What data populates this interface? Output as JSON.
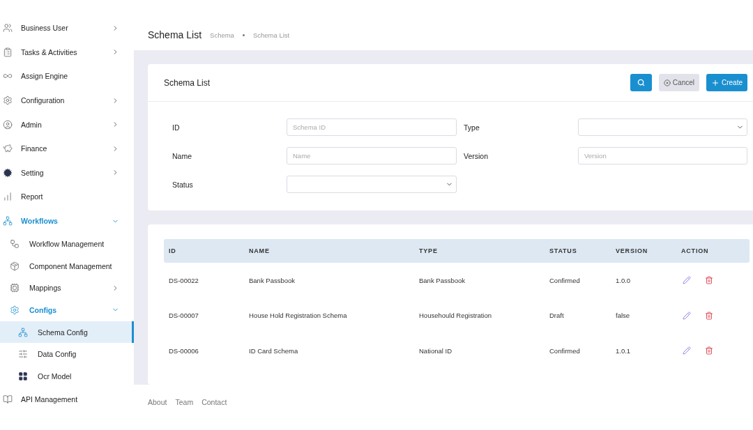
{
  "sidebar": {
    "items": [
      {
        "label": "Business User",
        "expanded": false,
        "selected": false
      },
      {
        "label": "Tasks & Activities",
        "expanded": false,
        "selected": false
      },
      {
        "label": "Assign Engine",
        "selected": false
      },
      {
        "label": "Configuration",
        "expanded": false,
        "selected": false
      },
      {
        "label": "Admin",
        "expanded": false,
        "selected": false
      },
      {
        "label": "Finance",
        "expanded": false,
        "selected": false
      },
      {
        "label": "Setting",
        "expanded": false,
        "selected": false
      },
      {
        "label": "Report",
        "selected": false
      },
      {
        "label": "Workflows",
        "expanded": true,
        "selected": false,
        "children": [
          {
            "label": "Workflow Management",
            "selected": false
          },
          {
            "label": "Component Management",
            "selected": false
          },
          {
            "label": "Mappings",
            "expanded": false,
            "selected": false
          },
          {
            "label": "Configs",
            "expanded": true,
            "selected": false,
            "children": [
              {
                "label": "Schema Config",
                "selected": true
              },
              {
                "label": "Data Config",
                "selected": false
              },
              {
                "label": "Ocr Model",
                "selected": false
              }
            ]
          }
        ]
      },
      {
        "label": "API Management",
        "selected": false
      }
    ]
  },
  "header": {
    "title": "Schema List",
    "breadcrumb": [
      "Schema",
      "Schema List"
    ]
  },
  "filter_card": {
    "title": "Schema List",
    "buttons": [
      {
        "kind": "search"
      },
      {
        "kind": "cancel",
        "label": "Cancel"
      },
      {
        "kind": "create",
        "label": "Create"
      }
    ],
    "fields": [
      {
        "label": "ID",
        "kind": "text",
        "placeholder": "Schema ID"
      },
      {
        "label": "Type",
        "kind": "select"
      },
      {
        "label": "Name",
        "kind": "text",
        "placeholder": "Name"
      },
      {
        "label": "Version",
        "kind": "text",
        "placeholder": "Version"
      },
      {
        "label": "Status",
        "kind": "select"
      }
    ]
  },
  "table": {
    "columns": [
      "ID",
      "NAME",
      "TYPE",
      "STATUS",
      "VERSION",
      "ACTION"
    ],
    "rows": [
      {
        "cells": [
          "DS-00022",
          "Bank Passbook",
          "Bank Passbook",
          "Confirmed",
          "1.0.0"
        ]
      },
      {
        "cells": [
          "DS-00007",
          "House Hold Registration Schema",
          "Househould Registration",
          "Draft",
          "false"
        ]
      },
      {
        "cells": [
          "DS-00006",
          "ID Card Schema",
          "National ID",
          "Confirmed",
          "1.0.1"
        ]
      }
    ]
  },
  "footer": {
    "links": [
      "About",
      "Team",
      "Contact"
    ]
  }
}
